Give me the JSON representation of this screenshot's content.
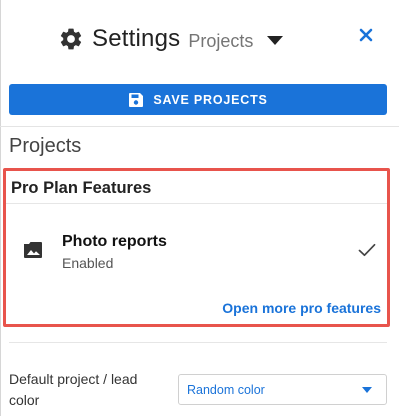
{
  "header": {
    "title": "Settings",
    "subtitle": "Projects",
    "settings_icon": "gear-icon",
    "dropdown_icon": "caret-down-icon",
    "close_icon": "close-icon"
  },
  "toolbar": {
    "save_label": "SAVE PROJECTS",
    "save_icon": "floppy-disk-icon"
  },
  "section": {
    "title": "Projects"
  },
  "pro_features": {
    "title": "Pro Plan Features",
    "items": [
      {
        "icon": "photo-icon",
        "name": "Photo reports",
        "status": "Enabled",
        "checked": true
      }
    ],
    "more_link": "Open more pro features"
  },
  "settings": {
    "default_color_label": "Default project / lead color",
    "default_color_value": "Random color"
  },
  "colors": {
    "accent": "#1a73d9",
    "highlight_border": "#e8544c"
  }
}
